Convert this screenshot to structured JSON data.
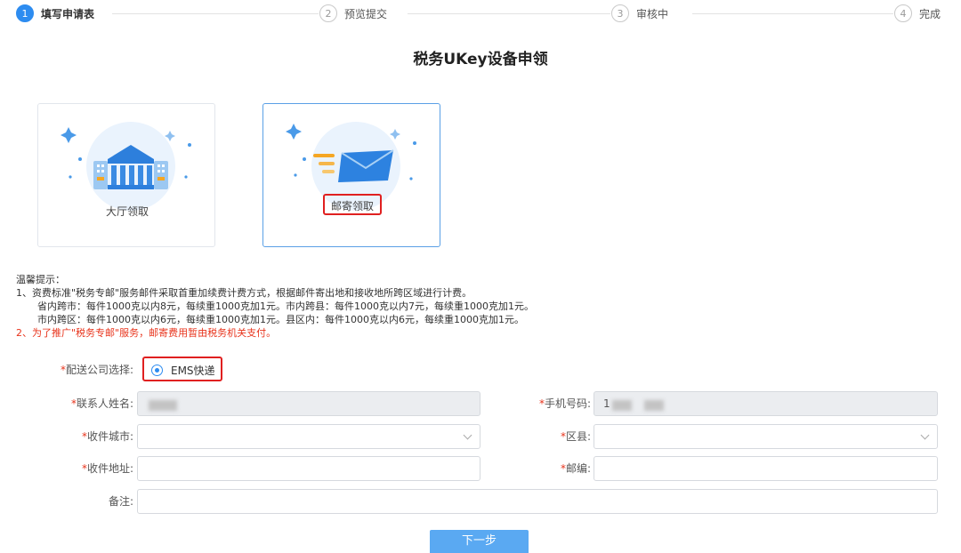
{
  "steps": [
    {
      "num": "1",
      "label": "填写申请表",
      "active": true
    },
    {
      "num": "2",
      "label": "预览提交",
      "active": false
    },
    {
      "num": "3",
      "label": "审核中",
      "active": false
    },
    {
      "num": "4",
      "label": "完成",
      "active": false
    }
  ],
  "title": "税务UKey设备申领",
  "cards": [
    {
      "label": "大厅领取",
      "icon": "bank-building-icon",
      "selected": false
    },
    {
      "label": "邮寄领取",
      "icon": "mail-envelope-icon",
      "selected": true
    }
  ],
  "tips": {
    "heading": "温馨提示：",
    "line1": "1、资费标准\"税务专邮\"服务邮件采取首重加续费计费方式，根据邮件寄出地和接收地所跨区域进行计费。",
    "line2": "省内跨市：每件1000克以内8元，每续重1000克加1元。市内跨县：每件1000克以内7元，每续重1000克加1元。",
    "line3": "市内跨区：每件1000克以内6元，每续重1000克加1元。县区内：每件1000克以内6元，每续重1000克加1元。",
    "line4": "2、为了推广\"税务专邮\"服务，邮寄费用暂由税务机关支付。"
  },
  "form": {
    "courier_label": "配送公司选择:",
    "courier_option": "EMS快递",
    "contact_label": "联系人姓名:",
    "phone_label": "手机号码:",
    "phone_value_prefix": "1",
    "city_label": "收件城市:",
    "district_label": "区县:",
    "address_label": "收件地址:",
    "zip_label": "邮编:",
    "note_label": "备注:",
    "required_mark": "*"
  },
  "next_button": "下一步",
  "colors": {
    "accent": "#2d8cf0",
    "highlight": "#e02020",
    "warning": "#e8341c",
    "button": "#5aa9f2"
  }
}
